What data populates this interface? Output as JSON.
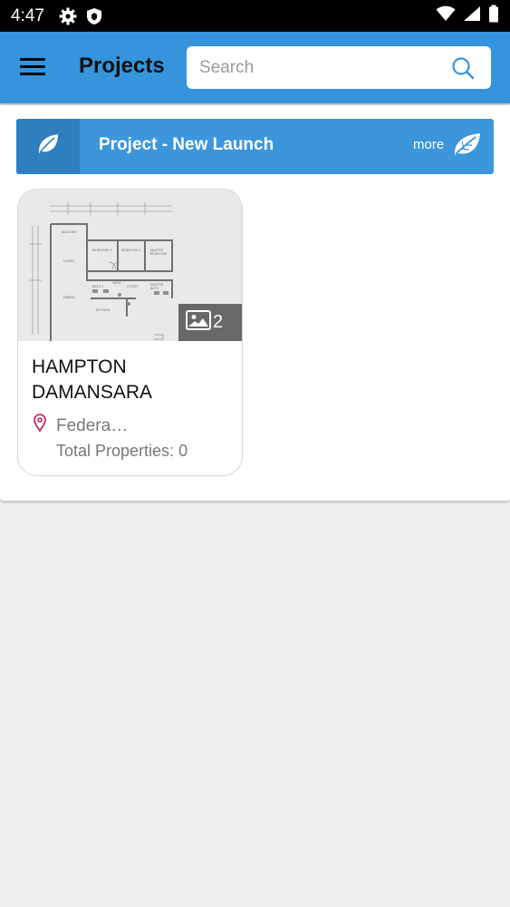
{
  "status_bar": {
    "time": "4:47"
  },
  "app_bar": {
    "title": "Projects"
  },
  "search": {
    "placeholder": "Search",
    "value": ""
  },
  "banner": {
    "title": "Project - New Launch",
    "more_label": "more"
  },
  "project_card": {
    "name": "HAMPTON DAMANSARA",
    "image_count": "2",
    "location": "Federa…",
    "total_label": "Total Properties:",
    "total_value": "0"
  },
  "colors": {
    "primary": "#3594dc",
    "banner": "#3b96dc",
    "banner_dark": "#2e7fc0",
    "pin": "#c2185b"
  }
}
